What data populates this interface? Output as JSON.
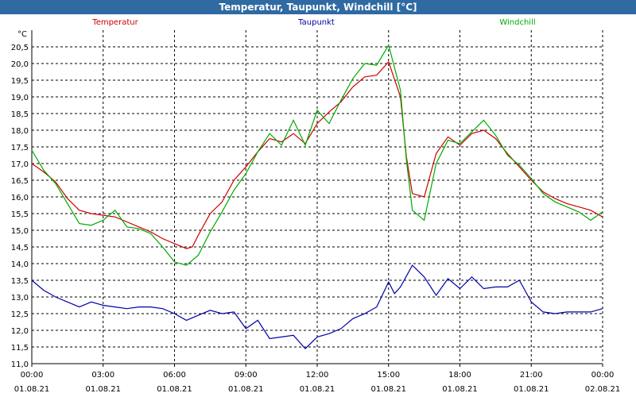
{
  "window": {
    "title": "Temperatur, Taupunkt, Windchill [°C]"
  },
  "chart_data": {
    "type": "line",
    "title": "Temperatur, Taupunkt, Windchill [°C]",
    "ylabel": "°C",
    "xlabel": "",
    "ylim": [
      11.0,
      21.0
    ],
    "xlim": [
      0,
      24
    ],
    "y_ticks": [
      "11,0",
      "11,5",
      "12,0",
      "12,5",
      "13,0",
      "13,5",
      "14,0",
      "14,5",
      "15,0",
      "15,5",
      "16,0",
      "16,5",
      "17,0",
      "17,5",
      "18,0",
      "18,5",
      "19,0",
      "19,5",
      "20,0",
      "20,5"
    ],
    "x_ticks": [
      {
        "time": "00:00",
        "date": "01.08.21",
        "x": 0
      },
      {
        "time": "03:00",
        "date": "01.08.21",
        "x": 3
      },
      {
        "time": "06:00",
        "date": "01.08.21",
        "x": 6
      },
      {
        "time": "09:00",
        "date": "01.08.21",
        "x": 9
      },
      {
        "time": "12:00",
        "date": "01.08.21",
        "x": 12
      },
      {
        "time": "15:00",
        "date": "01.08.21",
        "x": 15
      },
      {
        "time": "18:00",
        "date": "01.08.21",
        "x": 18
      },
      {
        "time": "21:00",
        "date": "01.08.21",
        "x": 21
      },
      {
        "time": "00:00",
        "date": "02.08.21",
        "x": 24
      }
    ],
    "grid": true,
    "legend_placement": "top",
    "series": [
      {
        "name": "Temperatur",
        "color": "#cc0000",
        "points": [
          [
            0,
            17.0
          ],
          [
            0.5,
            16.75
          ],
          [
            1,
            16.45
          ],
          [
            1.5,
            15.95
          ],
          [
            2,
            15.6
          ],
          [
            2.5,
            15.5
          ],
          [
            3,
            15.45
          ],
          [
            3.5,
            15.4
          ],
          [
            4,
            15.25
          ],
          [
            4.5,
            15.1
          ],
          [
            5,
            14.95
          ],
          [
            5.5,
            14.75
          ],
          [
            6,
            14.6
          ],
          [
            6.5,
            14.45
          ],
          [
            6.75,
            14.5
          ],
          [
            7,
            14.85
          ],
          [
            7.5,
            15.5
          ],
          [
            8,
            15.85
          ],
          [
            8.5,
            16.5
          ],
          [
            9,
            16.9
          ],
          [
            9.5,
            17.35
          ],
          [
            10,
            17.75
          ],
          [
            10.5,
            17.65
          ],
          [
            11,
            17.9
          ],
          [
            11.5,
            17.6
          ],
          [
            12,
            18.2
          ],
          [
            12.5,
            18.55
          ],
          [
            13,
            18.85
          ],
          [
            13.5,
            19.3
          ],
          [
            14,
            19.6
          ],
          [
            14.5,
            19.65
          ],
          [
            15,
            20.05
          ],
          [
            15.5,
            19.0
          ],
          [
            15.75,
            17.2
          ],
          [
            16,
            16.1
          ],
          [
            16.5,
            16.0
          ],
          [
            17,
            17.3
          ],
          [
            17.5,
            17.8
          ],
          [
            18,
            17.55
          ],
          [
            18.5,
            17.9
          ],
          [
            19,
            18.0
          ],
          [
            19.5,
            17.75
          ],
          [
            20,
            17.3
          ],
          [
            20.5,
            16.9
          ],
          [
            21,
            16.5
          ],
          [
            21.5,
            16.15
          ],
          [
            22,
            15.95
          ],
          [
            22.5,
            15.8
          ],
          [
            23,
            15.7
          ],
          [
            23.5,
            15.6
          ],
          [
            24,
            15.4
          ]
        ]
      },
      {
        "name": "Taupunkt",
        "color": "#0000aa",
        "points": [
          [
            0,
            13.5
          ],
          [
            0.5,
            13.2
          ],
          [
            1,
            13.0
          ],
          [
            1.5,
            12.85
          ],
          [
            2,
            12.7
          ],
          [
            2.5,
            12.85
          ],
          [
            3,
            12.75
          ],
          [
            3.5,
            12.7
          ],
          [
            4,
            12.65
          ],
          [
            4.5,
            12.7
          ],
          [
            5,
            12.7
          ],
          [
            5.5,
            12.65
          ],
          [
            6,
            12.5
          ],
          [
            6.5,
            12.3
          ],
          [
            7,
            12.45
          ],
          [
            7.5,
            12.6
          ],
          [
            8,
            12.5
          ],
          [
            8.5,
            12.55
          ],
          [
            9,
            12.05
          ],
          [
            9.5,
            12.3
          ],
          [
            10,
            11.75
          ],
          [
            10.5,
            11.8
          ],
          [
            11,
            11.85
          ],
          [
            11.5,
            11.45
          ],
          [
            12,
            11.8
          ],
          [
            12.5,
            11.9
          ],
          [
            13,
            12.05
          ],
          [
            13.5,
            12.35
          ],
          [
            14,
            12.5
          ],
          [
            14.5,
            12.7
          ],
          [
            15,
            13.45
          ],
          [
            15.25,
            13.1
          ],
          [
            15.5,
            13.3
          ],
          [
            16,
            13.95
          ],
          [
            16.5,
            13.6
          ],
          [
            17,
            13.05
          ],
          [
            17.5,
            13.55
          ],
          [
            18,
            13.25
          ],
          [
            18.5,
            13.6
          ],
          [
            19,
            13.25
          ],
          [
            19.5,
            13.3
          ],
          [
            20,
            13.3
          ],
          [
            20.5,
            13.5
          ],
          [
            21,
            12.85
          ],
          [
            21.5,
            12.55
          ],
          [
            22,
            12.5
          ],
          [
            22.5,
            12.55
          ],
          [
            23,
            12.55
          ],
          [
            23.5,
            12.55
          ],
          [
            24,
            12.65
          ]
        ]
      },
      {
        "name": "Windchill",
        "color": "#00aa00",
        "points": [
          [
            0,
            17.4
          ],
          [
            0.5,
            16.8
          ],
          [
            1,
            16.4
          ],
          [
            1.5,
            15.8
          ],
          [
            2,
            15.2
          ],
          [
            2.5,
            15.15
          ],
          [
            3,
            15.3
          ],
          [
            3.5,
            15.6
          ],
          [
            4,
            15.1
          ],
          [
            4.5,
            15.05
          ],
          [
            5,
            14.9
          ],
          [
            5.5,
            14.5
          ],
          [
            6,
            14.05
          ],
          [
            6.5,
            13.95
          ],
          [
            7,
            14.25
          ],
          [
            7.5,
            14.95
          ],
          [
            8,
            15.55
          ],
          [
            8.5,
            16.2
          ],
          [
            9,
            16.7
          ],
          [
            9.5,
            17.35
          ],
          [
            10,
            17.9
          ],
          [
            10.5,
            17.55
          ],
          [
            11,
            18.3
          ],
          [
            11.5,
            17.55
          ],
          [
            12,
            18.6
          ],
          [
            12.5,
            18.2
          ],
          [
            13,
            18.9
          ],
          [
            13.5,
            19.55
          ],
          [
            14,
            20.0
          ],
          [
            14.5,
            19.95
          ],
          [
            15,
            20.55
          ],
          [
            15.5,
            19.2
          ],
          [
            15.75,
            17.1
          ],
          [
            16,
            15.6
          ],
          [
            16.5,
            15.3
          ],
          [
            17,
            17.0
          ],
          [
            17.5,
            17.7
          ],
          [
            18,
            17.6
          ],
          [
            18.5,
            17.95
          ],
          [
            19,
            18.3
          ],
          [
            19.5,
            17.85
          ],
          [
            20,
            17.25
          ],
          [
            20.5,
            16.95
          ],
          [
            21,
            16.55
          ],
          [
            21.5,
            16.1
          ],
          [
            22,
            15.85
          ],
          [
            22.5,
            15.7
          ],
          [
            23,
            15.55
          ],
          [
            23.5,
            15.3
          ],
          [
            24,
            15.55
          ]
        ]
      }
    ]
  }
}
